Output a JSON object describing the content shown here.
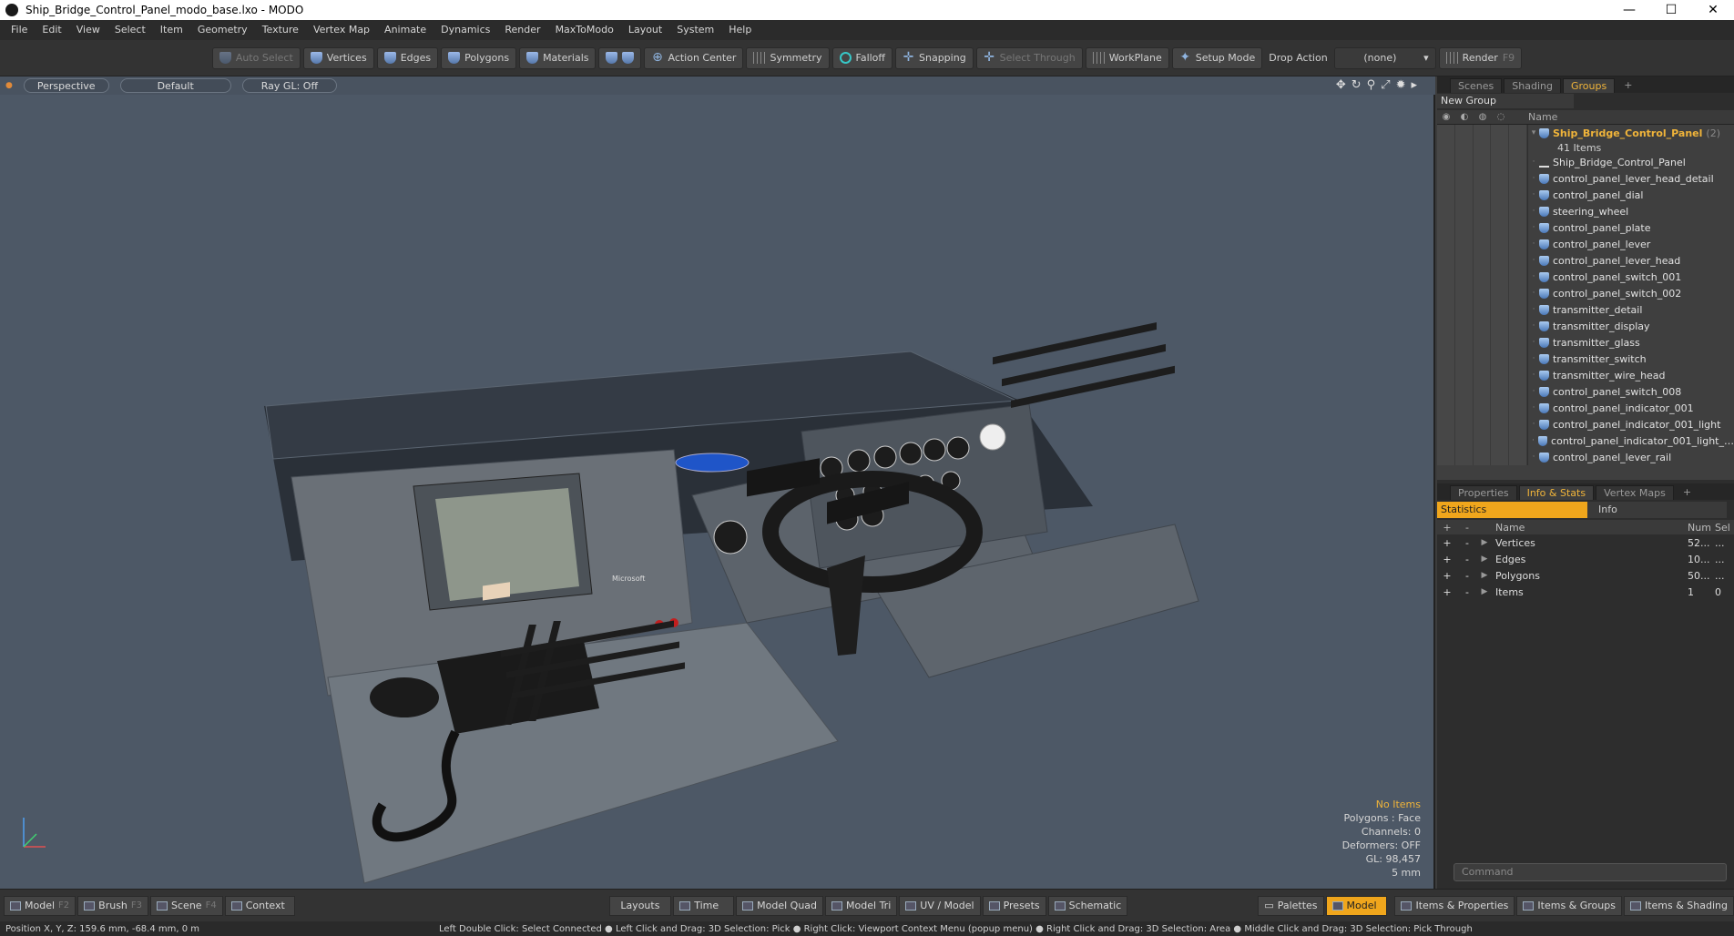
{
  "window": {
    "title": "Ship_Bridge_Control_Panel_modo_base.lxo - MODO",
    "min": "—",
    "max": "☐",
    "close": "✕"
  },
  "menu": [
    "File",
    "Edit",
    "View",
    "Select",
    "Item",
    "Geometry",
    "Texture",
    "Vertex Map",
    "Animate",
    "Dynamics",
    "Render",
    "MaxToModo",
    "Layout",
    "System",
    "Help"
  ],
  "toolbar": {
    "auto_select": "Auto Select",
    "vertices": "Vertices",
    "edges": "Edges",
    "polygons": "Polygons",
    "materials": "Materials",
    "action_center": "Action Center",
    "symmetry": "Symmetry",
    "falloff": "Falloff",
    "snapping": "Snapping",
    "select_through": "Select Through",
    "workplane": "WorkPlane",
    "setup_mode": "Setup Mode",
    "drop_action": "Drop Action",
    "drop_value": "(none)",
    "render": "Render",
    "render_key": "F9"
  },
  "viewport": {
    "view": "Perspective",
    "shading": "Default",
    "raygl": "Ray GL: Off",
    "stats": {
      "items": "No Items",
      "polygons": "Polygons : Face",
      "channels": "Channels: 0",
      "deformers": "Deformers: OFF",
      "gl": "GL: 98,457",
      "scale": "5 mm"
    },
    "panel_label": "Microsoft"
  },
  "scene_panel": {
    "tabs": [
      "Scenes",
      "Shading",
      "Groups"
    ],
    "active_tab": "Groups",
    "new_group": "New Group",
    "name_header": "Name",
    "group": {
      "name": "Ship_Bridge_Control_Panel",
      "count": "(2)",
      "items": "41 Items"
    },
    "items": [
      "Ship_Bridge_Control_Panel",
      "control_panel_lever_head_detail",
      "control_panel_dial",
      "steering_wheel",
      "control_panel_plate",
      "control_panel_lever",
      "control_panel_lever_head",
      "control_panel_switch_001",
      "control_panel_switch_002",
      "transmitter_detail",
      "transmitter_display",
      "transmitter_glass",
      "transmitter_switch",
      "transmitter_wire_head",
      "control_panel_switch_008",
      "control_panel_indicator_001",
      "control_panel_indicator_001_light",
      "control_panel_indicator_001_light_…",
      "control_panel_lever_rail"
    ]
  },
  "info_panel": {
    "tabs": [
      "Properties",
      "Info & Stats",
      "Vertex Maps"
    ],
    "active_tab": "Info & Stats",
    "sub_tabs": [
      "Statistics",
      "Info"
    ],
    "headers": {
      "name": "Name",
      "num": "Num",
      "sel": "Sel"
    },
    "rows": [
      {
        "name": "Vertices",
        "num": "52...",
        "sel": "..."
      },
      {
        "name": "Edges",
        "num": "10...",
        "sel": "..."
      },
      {
        "name": "Polygons",
        "num": "50...",
        "sel": "..."
      },
      {
        "name": "Items",
        "num": "1",
        "sel": "0"
      }
    ],
    "command_placeholder": "Command"
  },
  "bottom": {
    "model": "Model",
    "model_key": "F2",
    "brush": "Brush",
    "brush_key": "F3",
    "scene": "Scene",
    "scene_key": "F4",
    "context": "Context",
    "layouts": "Layouts",
    "time": "Time",
    "model_quad": "Model Quad",
    "model_tri": "Model Tri",
    "uv_model": "UV / Model",
    "presets": "Presets",
    "schematic": "Schematic",
    "palettes": "Palettes",
    "model2": "Model",
    "items_props": "Items & Properties",
    "items_groups": "Items & Groups",
    "items_shading": "Items & Shading"
  },
  "status": {
    "position": "Position X, Y, Z:   159.6 mm, -68.4 mm, 0 m",
    "hint": "Left Double Click: Select Connected ● Left Click and Drag: 3D Selection: Pick ● Right Click: Viewport Context Menu (popup menu) ● Right Click and Drag: 3D Selection: Area ● Middle Click and Drag: 3D Selection: Pick Through"
  }
}
